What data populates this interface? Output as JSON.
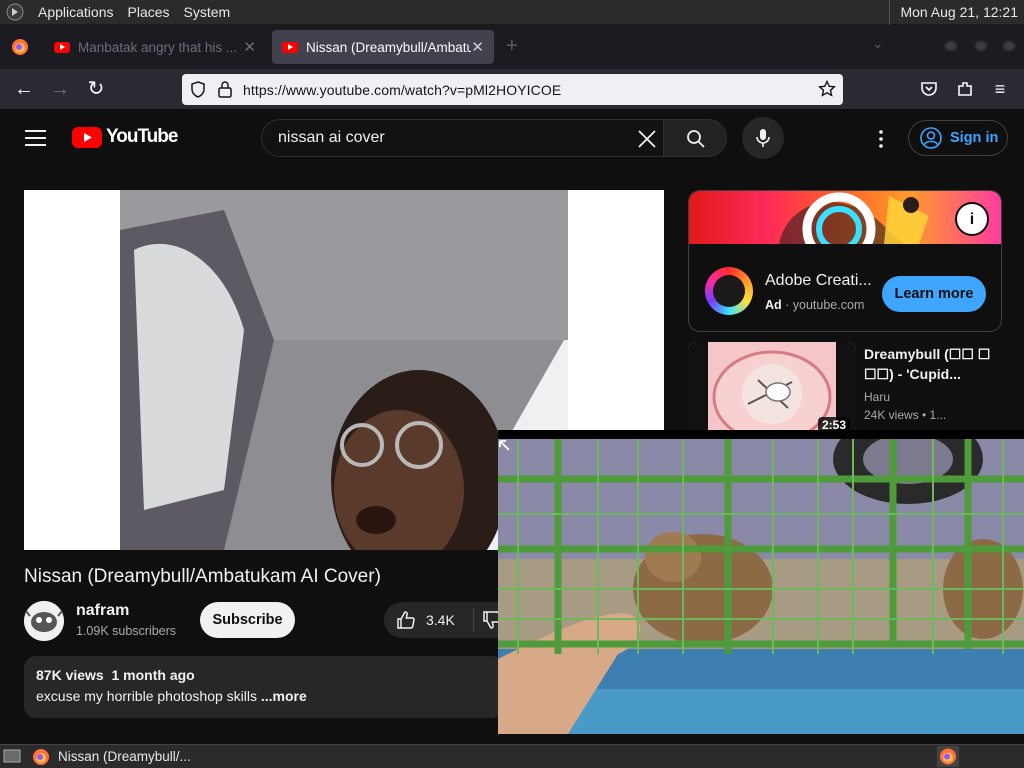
{
  "topbar": {
    "menu": [
      "Applications",
      "Places",
      "System"
    ],
    "clock": "Mon Aug 21, 12:21"
  },
  "browser": {
    "tabs": [
      {
        "title": "Manbatak angry that his ...",
        "active": false
      },
      {
        "title": "Nissan (Dreamybull/Ambatu",
        "active": true
      }
    ],
    "url": "https://www.youtube.com/watch?v=pMl2HOYICOE"
  },
  "youtube": {
    "logo": "YouTube",
    "search_query": "nissan ai cover",
    "signin_label": "Sign in"
  },
  "video": {
    "title": "Nissan (Dreamybull/Ambatukam AI Cover)",
    "channel": "nafram",
    "subscribers": "1.09K subscribers",
    "subscribe_label": "Subscribe",
    "likes": "3.4K",
    "views": "87K views",
    "posted": "1 month ago",
    "description": "excuse my horrible photoshop skills ",
    "more_label": "...more"
  },
  "ad": {
    "title": "Adobe Creati...",
    "label": "Ad",
    "domain": "youtube.com",
    "cta": "Learn more",
    "info_icon": "i"
  },
  "recommended": [
    {
      "title": "Dreamybull (☐☐ ☐ ☐☐) - 'Cupid...",
      "channel": "Haru",
      "meta": "24K views • 1...",
      "duration": "2:53"
    }
  ],
  "taskbar": {
    "window_title": "Nissan (Dreamybull/..."
  }
}
